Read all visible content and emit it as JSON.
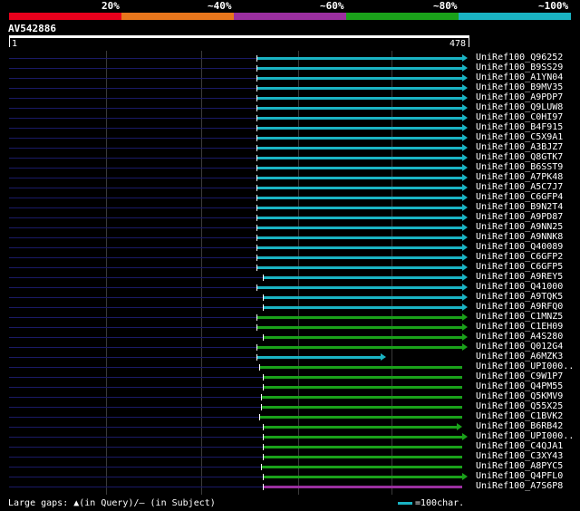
{
  "scale": {
    "labels": [
      "20%",
      "~40%",
      "~60%",
      "~80%",
      "~100%"
    ],
    "colors": [
      "#e8001c",
      "#e8761c",
      "#9b2fa0",
      "#1aa11a",
      "#1ab3c3"
    ]
  },
  "query": {
    "name": "AV542886",
    "start": "1",
    "end": "478"
  },
  "hits": [
    {
      "name": "UniRef100_Q96252",
      "color": "#1ab3c3",
      "start": 283,
      "end": 510,
      "arrow": true
    },
    {
      "name": "UniRef100_B9SS29",
      "color": "#1ab3c3",
      "start": 283,
      "end": 510,
      "arrow": true
    },
    {
      "name": "UniRef100_A1YN04",
      "color": "#1ab3c3",
      "start": 283,
      "end": 510,
      "arrow": true
    },
    {
      "name": "UniRef100_B9MV35",
      "color": "#1ab3c3",
      "start": 283,
      "end": 510,
      "arrow": true
    },
    {
      "name": "UniRef100_A9PDP7",
      "color": "#1ab3c3",
      "start": 283,
      "end": 510,
      "arrow": true
    },
    {
      "name": "UniRef100_Q9LUW8",
      "color": "#1ab3c3",
      "start": 283,
      "end": 510,
      "arrow": true
    },
    {
      "name": "UniRef100_C0HI97",
      "color": "#1ab3c3",
      "start": 283,
      "end": 510,
      "arrow": true
    },
    {
      "name": "UniRef100_B4F915",
      "color": "#1ab3c3",
      "start": 283,
      "end": 510,
      "arrow": true
    },
    {
      "name": "UniRef100_C5X9A1",
      "color": "#1ab3c3",
      "start": 283,
      "end": 510,
      "arrow": true
    },
    {
      "name": "UniRef100_A3BJZ7",
      "color": "#1ab3c3",
      "start": 283,
      "end": 510,
      "arrow": true
    },
    {
      "name": "UniRef100_Q8GTK7",
      "color": "#1ab3c3",
      "start": 283,
      "end": 510,
      "arrow": true
    },
    {
      "name": "UniRef100_B6SST9",
      "color": "#1ab3c3",
      "start": 283,
      "end": 510,
      "arrow": true
    },
    {
      "name": "UniRef100_A7PK48",
      "color": "#1ab3c3",
      "start": 283,
      "end": 510,
      "arrow": true
    },
    {
      "name": "UniRef100_A5C7J7",
      "color": "#1ab3c3",
      "start": 283,
      "end": 510,
      "arrow": true
    },
    {
      "name": "UniRef100_C6GFP4",
      "color": "#1ab3c3",
      "start": 283,
      "end": 510,
      "arrow": true
    },
    {
      "name": "UniRef100_B9N2T4",
      "color": "#1ab3c3",
      "start": 283,
      "end": 510,
      "arrow": true
    },
    {
      "name": "UniRef100_A9PD87",
      "color": "#1ab3c3",
      "start": 283,
      "end": 510,
      "arrow": true
    },
    {
      "name": "UniRef100_A9NN25",
      "color": "#1ab3c3",
      "start": 283,
      "end": 510,
      "arrow": true
    },
    {
      "name": "UniRef100_A9NNK8",
      "color": "#1ab3c3",
      "start": 283,
      "end": 510,
      "arrow": true
    },
    {
      "name": "UniRef100_Q40089",
      "color": "#1ab3c3",
      "start": 283,
      "end": 510,
      "arrow": true
    },
    {
      "name": "UniRef100_C6GFP2",
      "color": "#1ab3c3",
      "start": 283,
      "end": 510,
      "arrow": true
    },
    {
      "name": "UniRef100_C6GFP5",
      "color": "#1ab3c3",
      "start": 283,
      "end": 510,
      "arrow": true
    },
    {
      "name": "UniRef100_A9REY5",
      "color": "#1ab3c3",
      "start": 290,
      "end": 510,
      "arrow": true
    },
    {
      "name": "UniRef100_Q41000",
      "color": "#1ab3c3",
      "start": 283,
      "end": 510,
      "arrow": true
    },
    {
      "name": "UniRef100_A9TQK5",
      "color": "#1ab3c3",
      "start": 290,
      "end": 510,
      "arrow": true
    },
    {
      "name": "UniRef100_A9RFQ0",
      "color": "#1ab3c3",
      "start": 290,
      "end": 510,
      "arrow": true
    },
    {
      "name": "UniRef100_C1MNZ5",
      "color": "#1aa11a",
      "start": 283,
      "end": 510,
      "arrow": true
    },
    {
      "name": "UniRef100_C1EH09",
      "color": "#1aa11a",
      "start": 283,
      "end": 510,
      "arrow": true
    },
    {
      "name": "UniRef100_A4S280",
      "color": "#1aa11a",
      "start": 290,
      "end": 510,
      "arrow": true
    },
    {
      "name": "UniRef100_Q012G4",
      "color": "#1aa11a",
      "start": 283,
      "end": 510,
      "arrow": true
    },
    {
      "name": "UniRef100_A6MZK3",
      "color": "#1ab3c3",
      "start": 283,
      "end": 420,
      "arrow": true
    },
    {
      "name": "UniRef100_UPI000..",
      "color": "#1aa11a",
      "start": 286,
      "end": 510,
      "arrow": false
    },
    {
      "name": "UniRef100_C9W1P7",
      "color": "#1aa11a",
      "start": 290,
      "end": 510,
      "arrow": false
    },
    {
      "name": "UniRef100_Q4PM55",
      "color": "#1aa11a",
      "start": 290,
      "end": 510,
      "arrow": false
    },
    {
      "name": "UniRef100_Q5KMV9",
      "color": "#1aa11a",
      "start": 288,
      "end": 510,
      "arrow": false
    },
    {
      "name": "UniRef100_Q55X25",
      "color": "#1aa11a",
      "start": 288,
      "end": 510,
      "arrow": false
    },
    {
      "name": "UniRef100_C1BVK2",
      "color": "#1aa11a",
      "start": 286,
      "end": 510,
      "arrow": false
    },
    {
      "name": "UniRef100_B6RB42",
      "color": "#1aa11a",
      "start": 290,
      "end": 504,
      "arrow": true
    },
    {
      "name": "UniRef100_UPI000..",
      "color": "#1aa11a",
      "start": 290,
      "end": 510,
      "arrow": true
    },
    {
      "name": "UniRef100_C4QJA1",
      "color": "#1aa11a",
      "start": 290,
      "end": 510,
      "arrow": false
    },
    {
      "name": "UniRef100_C3XY43",
      "color": "#1aa11a",
      "start": 290,
      "end": 510,
      "arrow": false
    },
    {
      "name": "UniRef100_A8PYC5",
      "color": "#1aa11a",
      "start": 288,
      "end": 510,
      "arrow": false
    },
    {
      "name": "UniRef100_Q4PFL0",
      "color": "#1aa11a",
      "start": 290,
      "end": 510,
      "arrow": true
    },
    {
      "name": "UniRef100_A7S6P8",
      "color": "#9b2fa0",
      "start": 290,
      "end": 510,
      "arrow": false
    }
  ],
  "footer": {
    "gaps_text": "Large gaps: ▲(in Query)/– (in Subject)",
    "legend_text": "=100char.",
    "legend_color": "#1ab3c3"
  }
}
